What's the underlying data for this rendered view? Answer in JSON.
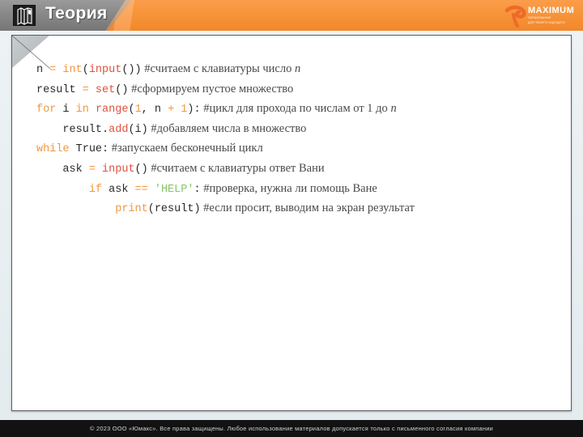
{
  "header": {
    "title": "Теория",
    "book_icon": "books-icon",
    "brand": {
      "name": "MAXIMUM",
      "sub1": "ОБРАЗОВАНИЕ",
      "sub2": "ДЛЯ ТВОЕГО БУДУЩЕГО",
      "swoosh_icon": "maximum-swoosh-icon"
    },
    "colors": {
      "orange": "#f7943a",
      "grey": "#8a8a8a"
    }
  },
  "panel": {
    "fold_icon": "page-fold-corner"
  },
  "code": {
    "language": "python",
    "colors": {
      "keyword": "#f0973f",
      "function": "#e0513d",
      "string": "#86c46a",
      "plain": "#2a2a2a",
      "comment": "#4a4a4a"
    },
    "lines": [
      {
        "indent": 0,
        "tokens": [
          {
            "t": "n ",
            "c": "pl"
          },
          {
            "t": "= ",
            "c": "op"
          },
          {
            "t": "int",
            "c": "kw"
          },
          {
            "t": "(",
            "c": "pl"
          },
          {
            "t": "input",
            "c": "fn"
          },
          {
            "t": "())",
            "c": "pl"
          }
        ],
        "comment": "#считаем с клавиатуры число ",
        "comment_italic": "n"
      },
      {
        "indent": 0,
        "tokens": [
          {
            "t": "result ",
            "c": "pl"
          },
          {
            "t": "= ",
            "c": "op"
          },
          {
            "t": "set",
            "c": "fn"
          },
          {
            "t": "()",
            "c": "pl"
          }
        ],
        "comment": "#сформируем пустое множество",
        "comment_italic": ""
      },
      {
        "indent": 0,
        "tokens": [
          {
            "t": "for",
            "c": "kw"
          },
          {
            "t": " i ",
            "c": "pl"
          },
          {
            "t": "in",
            "c": "kw"
          },
          {
            "t": " ",
            "c": "pl"
          },
          {
            "t": "range",
            "c": "fn"
          },
          {
            "t": "(",
            "c": "pl"
          },
          {
            "t": "1",
            "c": "num"
          },
          {
            "t": ", n ",
            "c": "pl"
          },
          {
            "t": "+",
            "c": "op"
          },
          {
            "t": " ",
            "c": "pl"
          },
          {
            "t": "1",
            "c": "num"
          },
          {
            "t": "):",
            "c": "pl"
          }
        ],
        "comment": "#цикл для прохода по числам от 1 до ",
        "comment_italic": "n"
      },
      {
        "indent": 1,
        "tokens": [
          {
            "t": "result.",
            "c": "pl"
          },
          {
            "t": "add",
            "c": "fn"
          },
          {
            "t": "(i)",
            "c": "pl"
          }
        ],
        "comment": "#добавляем числа в множество",
        "comment_italic": ""
      },
      {
        "indent": 0,
        "tokens": [
          {
            "t": "while",
            "c": "kw"
          },
          {
            "t": " True:",
            "c": "pl"
          }
        ],
        "comment": "#запускаем бесконечный цикл",
        "comment_italic": ""
      },
      {
        "indent": 1,
        "tokens": [
          {
            "t": "ask ",
            "c": "pl"
          },
          {
            "t": "= ",
            "c": "op"
          },
          {
            "t": "input",
            "c": "fn"
          },
          {
            "t": "()",
            "c": "pl"
          }
        ],
        "comment": "#считаем с клавиатуры ответ Вани",
        "comment_italic": ""
      },
      {
        "indent": 2,
        "tokens": [
          {
            "t": "if",
            "c": "kw"
          },
          {
            "t": " ask ",
            "c": "pl"
          },
          {
            "t": "==",
            "c": "op"
          },
          {
            "t": " ",
            "c": "pl"
          },
          {
            "t": "'HELP'",
            "c": "str"
          },
          {
            "t": ":",
            "c": "pl"
          }
        ],
        "comment": "#проверка, нужна ли помощь Ване",
        "comment_italic": ""
      },
      {
        "indent": 3,
        "tokens": [
          {
            "t": "print",
            "c": "kw"
          },
          {
            "t": "(result)",
            "c": "pl"
          }
        ],
        "comment": "#если просит, выводим на экран результат",
        "comment_italic": ""
      }
    ]
  },
  "footer": {
    "copyright": "© 2023 ООО «Юмакс». Все права защищены. Любое использование материалов допускается только с  письменного согласия компании"
  }
}
